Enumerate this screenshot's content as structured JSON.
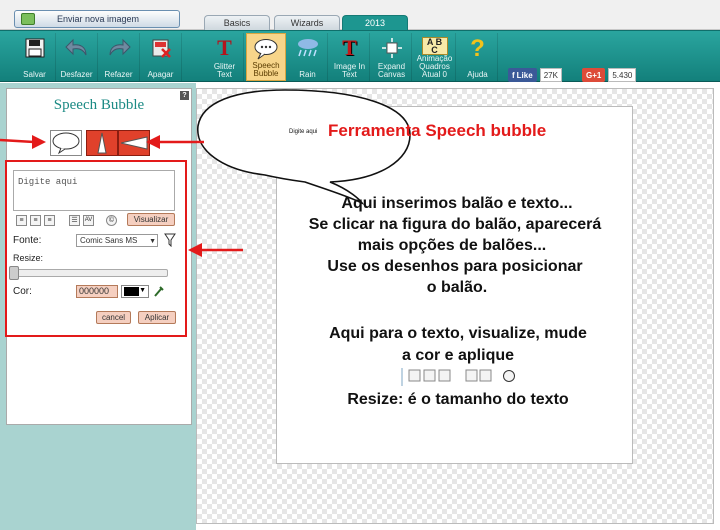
{
  "topbar": {
    "upload_label": "Enviar nova imagem",
    "tabs": [
      {
        "label": "Basics",
        "active": false
      },
      {
        "label": "Wizards",
        "active": false
      },
      {
        "label": "2013",
        "active": true
      }
    ]
  },
  "toolbar": {
    "buttons": [
      {
        "label": "Salvar",
        "icon": "floppy-disk-icon"
      },
      {
        "label": "Desfazer",
        "icon": "undo-arrow-icon"
      },
      {
        "label": "Refazer",
        "icon": "redo-arrow-icon"
      },
      {
        "label": "Apagar",
        "icon": "delete-icon"
      }
    ],
    "tools": [
      {
        "label1": "Glitter",
        "label2": "Text",
        "icon": "glitter-text-icon",
        "selected": false
      },
      {
        "label1": "Speech",
        "label2": "Bubble",
        "icon": "speech-bubble-icon",
        "selected": true
      },
      {
        "label1": "Rain",
        "label2": "",
        "icon": "rain-cloud-icon",
        "selected": false
      },
      {
        "label1": "Image In",
        "label2": "Text",
        "icon": "image-in-text-icon",
        "selected": false
      },
      {
        "label1": "Expand",
        "label2": "Canvas",
        "icon": "expand-canvas-icon",
        "selected": false
      },
      {
        "label1": "Animação",
        "label2": "",
        "label3": "Quadros",
        "label4": "Atual 0",
        "icon": "animation-abc-icon",
        "selected": false
      },
      {
        "label1": "Ajuda",
        "label2": "",
        "icon": "help-question-icon",
        "selected": false
      }
    ],
    "social": {
      "facebook_label": "Like",
      "facebook_count": "27K",
      "gplus_label": "G+1",
      "gplus_count": "5.430"
    }
  },
  "panel": {
    "title": "Speech Bubble",
    "help": "?",
    "text_placeholder": "Digite aqui",
    "preview_label": "Visualizar",
    "font_label": "Fonte:",
    "font_value": "Comic Sans MS",
    "resize_label": "Resize:",
    "resize_value": 0,
    "color_label": "Cor:",
    "color_value": "000000",
    "cancel_label": "cancel",
    "apply_label": "Aplicar"
  },
  "canvas": {
    "bubble_text": "Digite aqui"
  },
  "annotations": {
    "tool_title": "Ferramenta Speech bubble",
    "lines": [
      "Aqui inserimos balão e texto...",
      "Se clicar na figura do balão, aparecerá",
      "mais opções de balões...",
      "Use os desenhos para posicionar",
      "o balão.",
      "Aqui para o texto, visualize, mude",
      "a cor e aplique",
      "Resize: é o tamanho do texto"
    ]
  },
  "colors": {
    "toolbar": "#13807b",
    "annotation_red": "#e31a1a",
    "panel_title": "#1b8a84"
  }
}
